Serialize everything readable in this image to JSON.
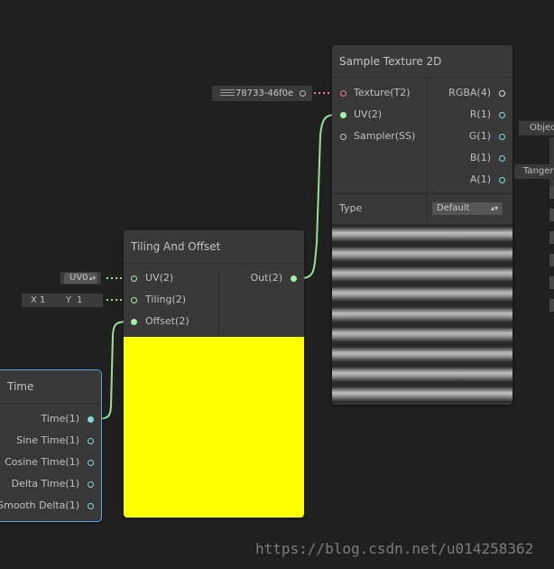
{
  "sample_texture_node": {
    "title": "Sample Texture 2D",
    "inputs": [
      "Texture(T2)",
      "UV(2)",
      "Sampler(SS)"
    ],
    "outputs": [
      "RGBA(4)",
      "R(1)",
      "G(1)",
      "B(1)",
      "A(1)"
    ],
    "type_label": "Type",
    "type_value": "Default",
    "texture_field_value": "78733-46f0e"
  },
  "tiling_offset_node": {
    "title": "Tiling And Offset",
    "inputs": [
      "UV(2)",
      "Tiling(2)",
      "Offset(2)"
    ],
    "output": "Out(2)",
    "preview_color": "#ffff00",
    "uv_field_value": "UV0",
    "tiling_x_label": "X",
    "tiling_x_value": "1",
    "tiling_y_label": "Y",
    "tiling_y_value": "1"
  },
  "time_node": {
    "title": "Time",
    "outputs": [
      "Time(1)",
      "Sine Time(1)",
      "Cosine Time(1)",
      "Delta Time(1)",
      "Smooth Delta(1)"
    ],
    "selection_color": "#5aa7d8"
  },
  "right_partial_fields": [
    "Objec",
    "Tanger"
  ],
  "watermark": "https://blog.csdn.net/u014258362",
  "colors": {
    "background": "#202020",
    "node_body": "#383838",
    "texture_port": "#e88888",
    "vector_port": "#a8f0a8",
    "float_port": "#86d8d8",
    "wire_green": "#98e098"
  }
}
